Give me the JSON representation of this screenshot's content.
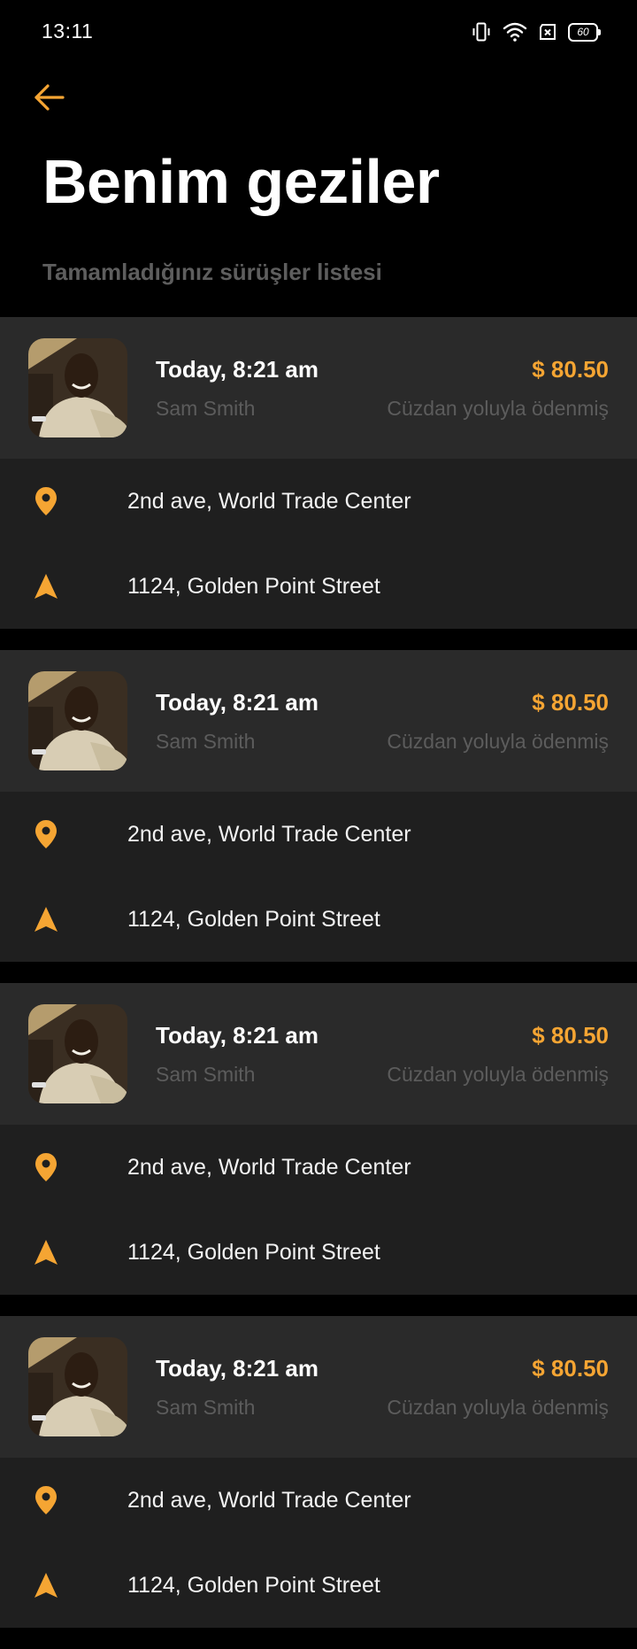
{
  "status_bar": {
    "time": "13:11",
    "battery": "60",
    "icons": [
      "vibrate-icon",
      "wifi-icon",
      "no-sim-icon",
      "battery-icon"
    ]
  },
  "header": {
    "back_icon": "arrow-left-icon",
    "title": "Benim geziler",
    "subtitle": "Tamamladığınız sürüşler listesi"
  },
  "colors": {
    "accent": "#f5a533",
    "background": "#000000",
    "card_header": "#2a2a2a",
    "card_body": "#1f1f1f",
    "muted_text": "#5c5c5c"
  },
  "trips": [
    {
      "time": "Today, 8:21 am",
      "driver": "Sam Smith",
      "price": "$ 80.50",
      "payment": "Cüzdan yoluyla ödenmiş",
      "pickup": "2nd ave, World Trade Center",
      "dropoff": "1124, Golden Point Street",
      "pickup_icon": "location-pin-icon",
      "dropoff_icon": "navigation-arrow-icon"
    },
    {
      "time": "Today, 8:21 am",
      "driver": "Sam Smith",
      "price": "$ 80.50",
      "payment": "Cüzdan yoluyla ödenmiş",
      "pickup": "2nd ave, World Trade Center",
      "dropoff": "1124, Golden Point Street",
      "pickup_icon": "location-pin-icon",
      "dropoff_icon": "navigation-arrow-icon"
    },
    {
      "time": "Today, 8:21 am",
      "driver": "Sam Smith",
      "price": "$ 80.50",
      "payment": "Cüzdan yoluyla ödenmiş",
      "pickup": "2nd ave, World Trade Center",
      "dropoff": "1124, Golden Point Street",
      "pickup_icon": "location-pin-icon",
      "dropoff_icon": "navigation-arrow-icon"
    },
    {
      "time": "Today, 8:21 am",
      "driver": "Sam Smith",
      "price": "$ 80.50",
      "payment": "Cüzdan yoluyla ödenmiş",
      "pickup": "2nd ave, World Trade Center",
      "dropoff": "1124, Golden Point Street",
      "pickup_icon": "location-pin-icon",
      "dropoff_icon": "navigation-arrow-icon"
    }
  ]
}
